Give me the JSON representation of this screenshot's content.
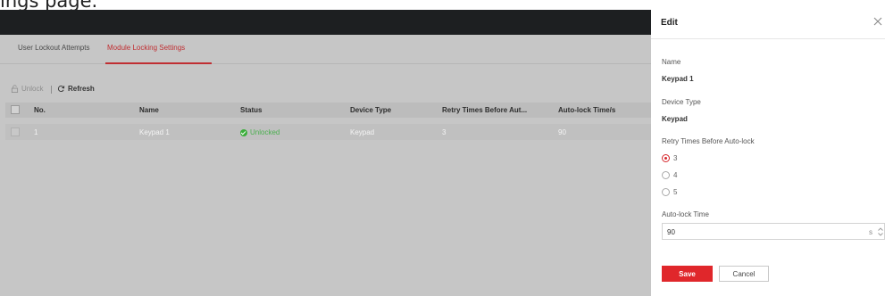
{
  "caption": {
    "text": "ings page."
  },
  "tabs": [
    {
      "label": "User Lockout Attempts"
    },
    {
      "label": "Module Locking Settings",
      "active": true
    }
  ],
  "toolbar": {
    "unlock_label": "Unlock",
    "refresh_label": "Refresh"
  },
  "table": {
    "columns": [
      "No.",
      "Name",
      "Status",
      "Device Type",
      "Retry Times Before Aut...",
      "Auto-lock Time/s"
    ],
    "rows": [
      {
        "no": "1",
        "name": "Keypad 1",
        "status": "Unlocked",
        "device_type": "Keypad",
        "retry": "3",
        "auto_lock": "90"
      }
    ]
  },
  "drawer": {
    "title": "Edit",
    "name_label": "Name",
    "name_value": "Keypad 1",
    "type_label": "Device Type",
    "type_value": "Keypad",
    "retry_label": "Retry Times Before Auto-lock",
    "retry_options": [
      "3",
      "4",
      "5"
    ],
    "retry_selected": "3",
    "autolock_label": "Auto-lock Time",
    "autolock_value": "90",
    "autolock_unit": "s",
    "save_label": "Save",
    "cancel_label": "Cancel"
  },
  "colors": {
    "accent": "#e0272b",
    "status_ok": "#3cae3c",
    "topbar": "#1d1f21"
  }
}
